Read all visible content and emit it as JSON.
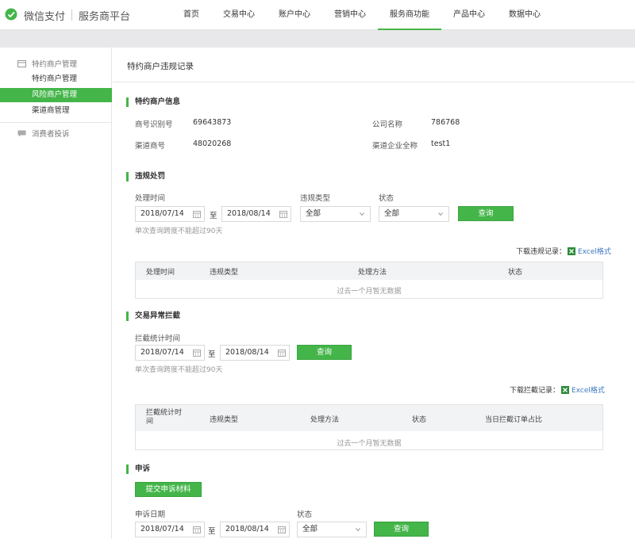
{
  "header": {
    "brand": "微信支付",
    "subtitle": "服务商平台",
    "nav": [
      "首页",
      "交易中心",
      "账户中心",
      "营销中心",
      "服务商功能",
      "产品中心",
      "数据中心"
    ],
    "active_nav": "服务商功能"
  },
  "sidebar": {
    "group1": "特约商户管理",
    "items": [
      "特约商户管理",
      "风险商户管理",
      "渠道商管理"
    ],
    "active_item": "风险商户管理",
    "group2": "消费者投诉"
  },
  "page": {
    "title": "特约商户违规记录"
  },
  "merchant_info": {
    "section_title": "特约商户信息",
    "merchant_id_label": "商号识别号",
    "merchant_id": "69643873",
    "company_label": "公司名称",
    "company": "786768",
    "channel_id_label": "渠道商号",
    "channel_id": "48020268",
    "channel_name_label": "渠道企业全称",
    "channel_name": "test1"
  },
  "violation": {
    "section_title": "违规处罚",
    "time_label": "处理时间",
    "start_date": "2018/07/14",
    "to": "至",
    "end_date": "2018/08/14",
    "type_label": "违规类型",
    "type_value": "全部",
    "status_label": "状态",
    "status_value": "全部",
    "query_button": "查询",
    "hint": "单次查询跨度不能超过90天",
    "download_label": "下载违规记录：",
    "download_link": "Excel格式",
    "columns": [
      "处理时间",
      "违规类型",
      "处理方法",
      "状态"
    ],
    "empty": "过去一个月暂无数据"
  },
  "intercept": {
    "section_title": "交易异常拦截",
    "time_label": "拦截统计时间",
    "start_date": "2018/07/14",
    "to": "至",
    "end_date": "2018/08/14",
    "query_button": "查询",
    "hint": "单次查询跨度不能超过90天",
    "download_label": "下载拦截记录：",
    "download_link": "Excel格式",
    "columns": [
      "拦截统计时\n间",
      "违规类型",
      "处理方法",
      "状态",
      "当日拦截订单占比"
    ],
    "empty": "过去一个月暂无数据"
  },
  "appeal": {
    "section_title": "申诉",
    "submit_button": "提交申诉材料",
    "date_label": "申诉日期",
    "start_date": "2018/07/14",
    "to": "至",
    "end_date": "2018/08/14",
    "status_label": "状态",
    "status_value": "全部",
    "query_button": "查询"
  },
  "colors": {
    "accent": "#44b549",
    "link": "#3c78c0"
  }
}
